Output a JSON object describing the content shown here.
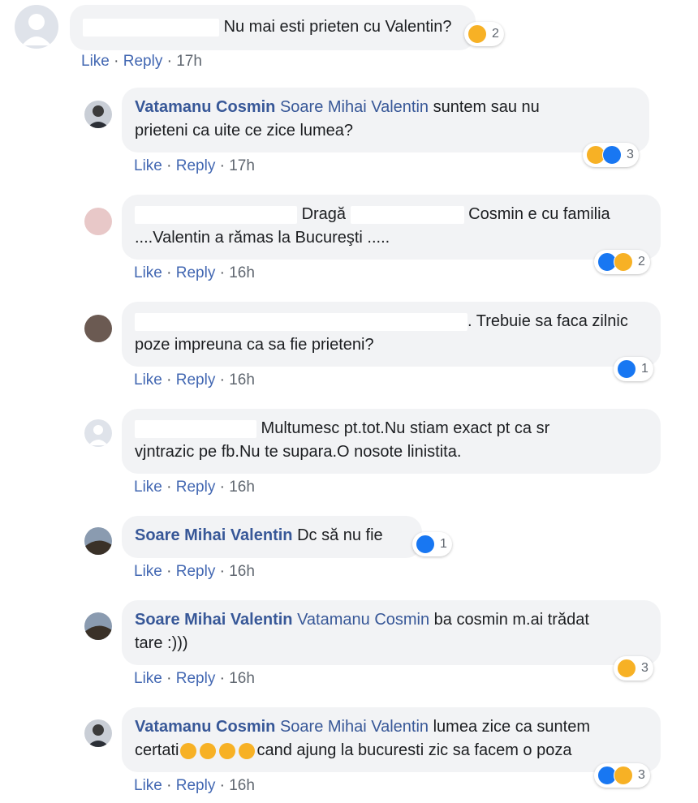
{
  "comments": [
    {
      "name": "",
      "tag": "",
      "text": "Nu mai esti prieten cu Valentin?",
      "reaction_count": "2",
      "like": "Like",
      "reply": "Reply",
      "time": "17h"
    },
    {
      "name": "Vatamanu Cosmin",
      "tag": "Soare Mihai Valentin",
      "text1": " suntem sau nu",
      "text2": "prieteni ca uite ce zice lumea?",
      "reaction_count": "3",
      "like": "Like",
      "reply": "Reply",
      "time": "17h"
    },
    {
      "text1": "Dragă",
      "text1b": " Cosmin e cu familia",
      "text2": "....Valentin a rămas la Bucureşti .....",
      "reaction_count": "2",
      "like": "Like",
      "reply": "Reply",
      "time": "16h"
    },
    {
      "text1": ". Trebuie sa faca zilnic",
      "text2": "poze impreuna ca sa fie prieteni?",
      "reaction_count": "1",
      "like": "Like",
      "reply": "Reply",
      "time": "16h"
    },
    {
      "text1": " Multumesc pt.tot.Nu stiam exact pt ca sr",
      "text2": "vjntrazic pe fb.Nu te supara.O nosote linistita.",
      "like": "Like",
      "reply": "Reply",
      "time": "16h"
    },
    {
      "name": "Soare Mihai Valentin",
      "text1": " Dc să nu fie",
      "reaction_count": "1",
      "like": "Like",
      "reply": "Reply",
      "time": "16h"
    },
    {
      "name": "Soare Mihai Valentin",
      "tag": "Vatamanu Cosmin",
      "text1": " ba cosmin m.ai trădat",
      "text2": "tare :)))",
      "reaction_count": "3",
      "like": "Like",
      "reply": "Reply",
      "time": "16h"
    },
    {
      "name": "Vatamanu Cosmin",
      "tag": "Soare Mihai Valentin",
      "text1": " lumea zice ca suntem",
      "text2a": "certati",
      "text2b": "cand ajung la bucuresti zic sa facem o poza",
      "reaction_count": "3",
      "like": "Like",
      "reply": "Reply",
      "time": "16h"
    }
  ],
  "colors": {
    "link": "#385898",
    "bubble": "#f2f3f5",
    "like_blue": "#1877f2",
    "haha_yellow": "#f7b125"
  },
  "icons": [
    "avatar-default",
    "avatar-photo",
    "haha-reaction-icon",
    "like-reaction-icon"
  ]
}
